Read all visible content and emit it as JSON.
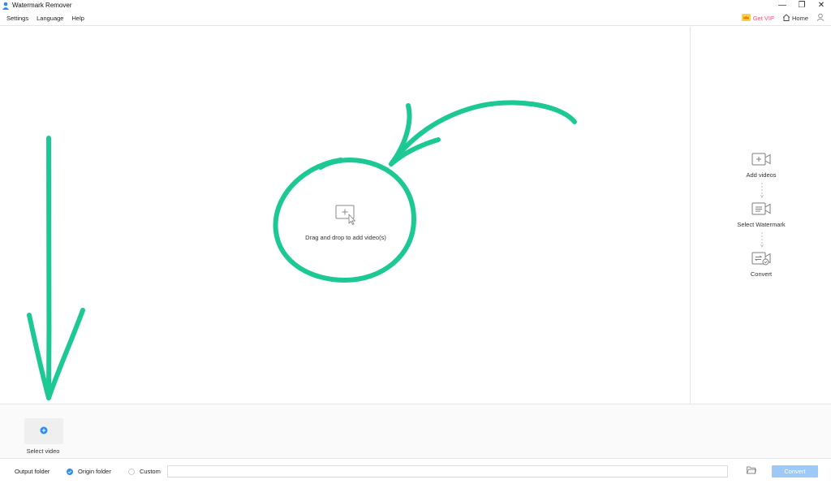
{
  "window": {
    "title": "Watermark Remover",
    "minimize": "—",
    "restore": "❐",
    "close": "✕"
  },
  "menu": {
    "items": [
      {
        "label": "Settings"
      },
      {
        "label": "Language"
      },
      {
        "label": "Help"
      }
    ],
    "get_vip": "Get VIP",
    "home": "Home"
  },
  "dropzone": {
    "label": "Drag and drop to add video(s)"
  },
  "steps": [
    {
      "label": "Add videos",
      "icon": "add-video-icon"
    },
    {
      "label": "Select Watermark",
      "icon": "select-watermark-icon"
    },
    {
      "label": "Convert",
      "icon": "convert-icon"
    }
  ],
  "queue": {
    "select_label": "Select video"
  },
  "footer": {
    "output_folder_label": "Output folder",
    "origin_folder_label": "Origin folder",
    "custom_label": "Custom",
    "path_value": "",
    "convert_label": "Convert",
    "origin_selected": true
  },
  "colors": {
    "accent": "#2d8cf0",
    "convert_disabled": "#9cc9f5",
    "vip": "#f5566b",
    "annotation": "#1cc995"
  }
}
